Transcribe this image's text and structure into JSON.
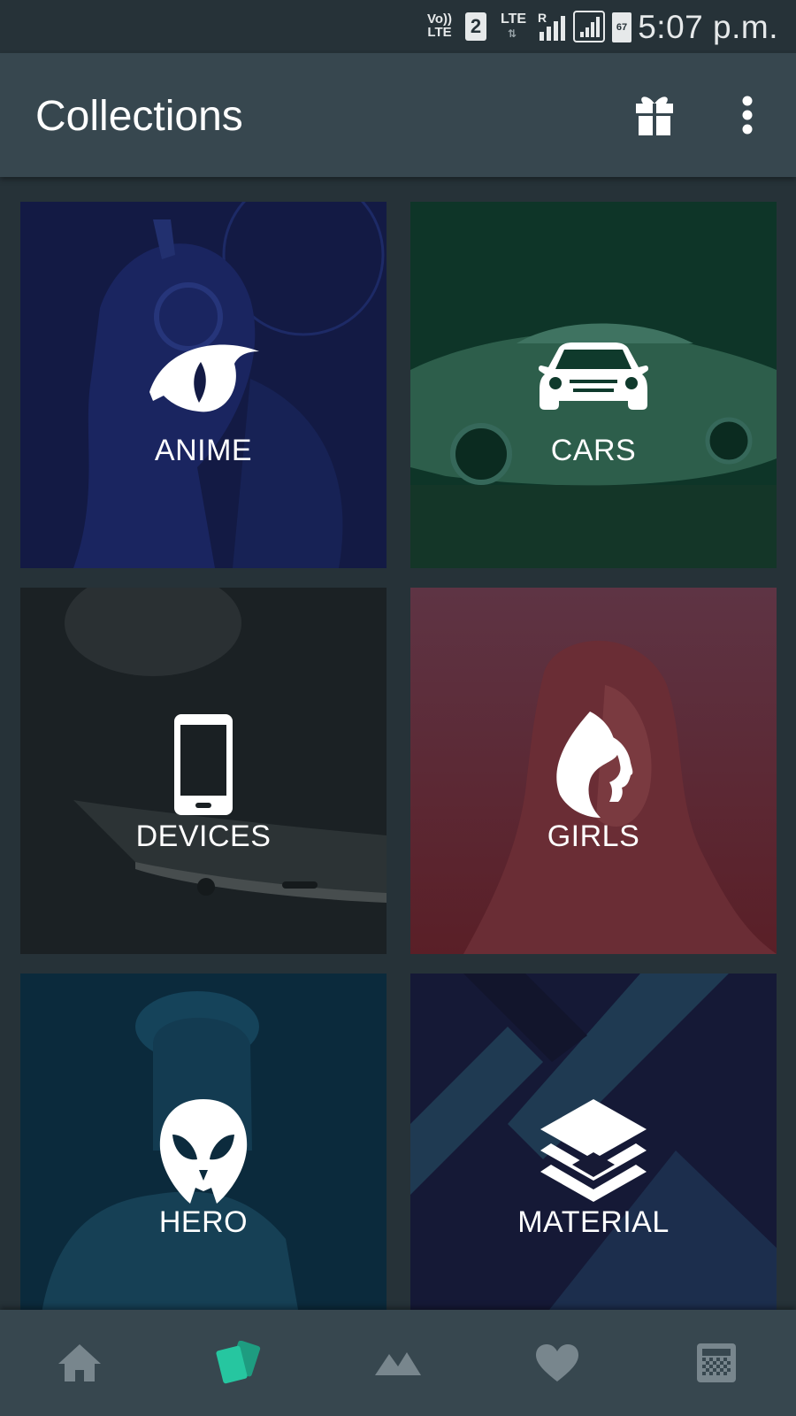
{
  "status_bar": {
    "volte": "Vo))",
    "volte_sub": "LTE",
    "sim_slot": "2",
    "network_lte": "LTE",
    "roaming": "R",
    "battery_level": "67",
    "time": "5:07 p.m."
  },
  "app_bar": {
    "title": "Collections",
    "gift_icon": "gift-icon",
    "menu_icon": "more-vert-icon"
  },
  "collections": [
    {
      "label": "ANIME",
      "icon": "anime-eye-icon",
      "color": "#141a45"
    },
    {
      "label": "CARS",
      "icon": "car-icon",
      "color": "#0f3a2c"
    },
    {
      "label": "DEVICES",
      "icon": "smartphone-icon",
      "color": "#1a2023"
    },
    {
      "label": "GIRLS",
      "icon": "girl-profile-icon",
      "color": "#5a2a33"
    },
    {
      "label": "HERO",
      "icon": "hero-mask-icon",
      "color": "#0c2b3d"
    },
    {
      "label": "MATERIAL",
      "icon": "layers-icon",
      "color": "#171a35"
    }
  ],
  "bottom_nav": {
    "items": [
      {
        "icon": "home-icon",
        "active": false
      },
      {
        "icon": "collections-icon",
        "active": true
      },
      {
        "icon": "landscape-icon",
        "active": false
      },
      {
        "icon": "heart-icon",
        "active": false
      },
      {
        "icon": "wallpaper-grid-icon",
        "active": false
      }
    ],
    "active_color": "#26c6a0",
    "inactive_color": "#78868d"
  }
}
